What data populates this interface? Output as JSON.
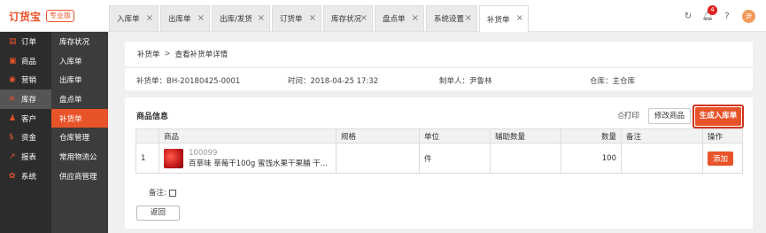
{
  "brand": {
    "name": "订货宝",
    "edition": "专业版"
  },
  "tabs": [
    {
      "label": "入库单",
      "active": false
    },
    {
      "label": "出库单",
      "active": false
    },
    {
      "label": "出库/发货",
      "active": false
    },
    {
      "label": "订货单",
      "active": false
    },
    {
      "label": "库存状况",
      "active": false
    },
    {
      "label": "盘点单",
      "active": false
    },
    {
      "label": "系统设置",
      "active": false
    },
    {
      "label": "补货单",
      "active": true
    }
  ],
  "topbar": {
    "notification_count": "4",
    "avatar_text": "尹"
  },
  "icons": {
    "refresh": "refresh-icon",
    "bell": "bell-icon",
    "help": "help-icon",
    "close": "close-icon",
    "printer": "printer-icon",
    "edit": "edit-icon"
  },
  "sidebar_primary": [
    {
      "label": "订单",
      "icon": "clipboard-icon",
      "glyph": "▤"
    },
    {
      "label": "商品",
      "icon": "bag-icon",
      "glyph": "▣"
    },
    {
      "label": "营销",
      "icon": "broadcast-icon",
      "glyph": "◉"
    },
    {
      "label": "库存",
      "icon": "layers-icon",
      "glyph": "≋"
    },
    {
      "label": "客户",
      "icon": "user-icon",
      "glyph": "♟"
    },
    {
      "label": "资金",
      "icon": "money-icon",
      "glyph": "$"
    },
    {
      "label": "报表",
      "icon": "chart-icon",
      "glyph": "↗"
    },
    {
      "label": "系统",
      "icon": "gear-icon",
      "glyph": "✿"
    }
  ],
  "sidebar_secondary": [
    {
      "label": "库存状况"
    },
    {
      "label": "入库单"
    },
    {
      "label": "出库单"
    },
    {
      "label": "盘点单"
    },
    {
      "label": "补货单"
    },
    {
      "label": "仓库管理"
    },
    {
      "label": "常用物流公"
    },
    {
      "label": "供应商管理"
    }
  ],
  "breadcrumb": {
    "parent": "补货单",
    "separator": ">",
    "current": "查看补货单详情"
  },
  "info": {
    "order_no_label": "补货单：",
    "order_no": "BH-20180425-0001",
    "time_label": "时间：",
    "time": "2018-04-25 17:32",
    "creator_label": "制单人：",
    "creator": "尹鲁林",
    "warehouse_label": "仓库：",
    "warehouse": "主仓库"
  },
  "products": {
    "title": "商品信息",
    "print_label": "打印",
    "edit_label": "修改商品",
    "generate_label": "生成入库单",
    "columns": [
      "",
      "商品",
      "规格",
      "单位",
      "辅助数量",
      "数量",
      "备注",
      "操作"
    ],
    "rows": [
      {
        "index": "1",
        "code": "100099",
        "name": "百草味 草莓干100g 蜜饯水果干果脯 干...",
        "spec": "",
        "unit": "件",
        "aux_qty": "",
        "qty": "100",
        "remark": "",
        "action": "添加"
      }
    ],
    "remark_label": "备注:",
    "back_label": "返回"
  },
  "colors": {
    "accent": "#e8542a",
    "highlight": "#d0331b",
    "sidebar_dark": "#2c2c2c",
    "sidebar_mid": "#3c3c3c"
  }
}
